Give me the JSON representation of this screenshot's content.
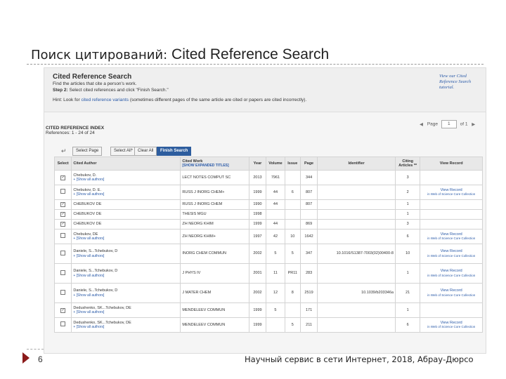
{
  "slide": {
    "title_ru": "Поиск цитирований:",
    "title_en": "Cited Reference Search",
    "page_number": "6",
    "footer": "Научный сервис в сети Интернет, 2018, Абрау-Дюрсо"
  },
  "header": {
    "title": "Cited Reference Search",
    "subtitle": "Find the articles that cite a person's work.",
    "step_label": "Step 2:",
    "step_text": "Select cited references and click \"Finish Search.\"",
    "hint_pre": "Hint: Look for",
    "hint_link": "cited reference variants",
    "hint_post": "(sometimes different pages of the same article are cited or papers are cited incorrectly).",
    "tutorial_line1": "View our Cited",
    "tutorial_line2": "Reference Search",
    "tutorial_line3": "tutorial."
  },
  "index": {
    "title": "CITED REFERENCE INDEX",
    "refs": "References: 1 - 24 of 24",
    "page_label": "Page",
    "page_value": "1",
    "of_label": "of 1",
    "prev_icon": "◀",
    "next_icon": "▶"
  },
  "toolbar": {
    "select_page": "Select Page",
    "select_all": "Select All*",
    "clear_all": "Clear All",
    "finish": "Finish Search"
  },
  "columns": {
    "select": "Select",
    "cited_author": "Cited Author",
    "cited_work": "Cited Work",
    "show_expanded": "[SHOW EXPANDED TITLES]",
    "year": "Year",
    "volume": "Volume",
    "issue": "Issue",
    "page": "Page",
    "identifier": "Identifier",
    "citing_articles": "Citing Articles **",
    "view_record": "View Record"
  },
  "rows": [
    {
      "checked": true,
      "author": "Chebukov, D.",
      "show": "+ [Show all authors]",
      "work": "LECT NOTES COMPUT SC",
      "year": "2013",
      "volume": "7961",
      "issue": "",
      "page": "344",
      "id": "",
      "citing": "3",
      "view": "",
      "view_sub": ""
    },
    {
      "checked": false,
      "author": "Chebukov, D. E.",
      "show": "+ [Show all authors]",
      "work": "RUSS J INORG CHEM+",
      "year": "1999",
      "volume": "44",
      "issue": "6",
      "page": "807",
      "id": "",
      "citing": "2",
      "view": "View Record",
      "view_sub": "in Web of Science Core Collection"
    },
    {
      "checked": true,
      "author": "CHEBUKOV DE",
      "show": "",
      "work": "RUSS J INORG CHEM",
      "year": "1990",
      "volume": "44",
      "issue": "",
      "page": "807",
      "id": "",
      "citing": "1",
      "view": "",
      "view_sub": ""
    },
    {
      "checked": true,
      "author": "CHEBUKOV DE",
      "show": "",
      "work": "THESIS MGU",
      "year": "1998",
      "volume": "",
      "issue": "",
      "page": "",
      "id": "",
      "citing": "1",
      "view": "",
      "view_sub": ""
    },
    {
      "checked": true,
      "author": "CHEBUKOV DE",
      "show": "",
      "work": "ZH NEORG KHIM",
      "year": "1999",
      "volume": "44",
      "issue": "",
      "page": "869",
      "id": "",
      "citing": "3",
      "view": "",
      "view_sub": ""
    },
    {
      "checked": false,
      "author": "Chebukov, DE",
      "show": "+ [Show all authors]",
      "work": "ZH NEORG KHIM+",
      "year": "1997",
      "volume": "42",
      "issue": "10",
      "page": "1642",
      "id": "",
      "citing": "6",
      "view": "View Record",
      "view_sub": "in Web of Science Core Collection"
    },
    {
      "checked": false,
      "author": "Daniele, S...Tchebukov, D",
      "show": "+ [Show all authors]",
      "work": "INORG CHEM COMMUN",
      "year": "2002",
      "volume": "5",
      "issue": "5",
      "page": "347",
      "id": "10.1016/S1387-7003(02)00400-8",
      "citing": "10",
      "view": "View Record",
      "view_sub": "in Web of Science Core Collection"
    },
    {
      "checked": false,
      "author": "Daniele, S...Tchebukov, D",
      "show": "+ [Show all authors]",
      "work": "J PHYS IV",
      "year": "2001",
      "volume": "11",
      "issue": "PR11",
      "page": "283",
      "id": "",
      "citing": "1",
      "view": "View Record",
      "view_sub": "in Web of Science Core Collection"
    },
    {
      "checked": false,
      "author": "Daniele, S...Tchebukov, D",
      "show": "+ [Show all authors]",
      "work": "J MATER CHEM",
      "year": "2002",
      "volume": "12",
      "issue": "8",
      "page": "2519",
      "id": "10.1039/b203346a",
      "citing": "21",
      "view": "View Record",
      "view_sub": "in Web of Science Core Collection"
    },
    {
      "checked": true,
      "author": "Dedushenko, SK...Tchebukov, DE",
      "show": "+ [Show all authors]",
      "work": "MENDELEEV COMMUN",
      "year": "1999",
      "volume": "5",
      "issue": "",
      "page": "171",
      "id": "",
      "citing": "1",
      "view": "",
      "view_sub": ""
    },
    {
      "checked": false,
      "author": "Dedushenko, SK...Tchebukov, DE",
      "show": "+ [Show all authors]",
      "work": "MENDELEEV COMMUN",
      "year": "1999",
      "volume": "",
      "issue": "5",
      "page": "211",
      "id": "",
      "citing": "6",
      "view": "View Record",
      "view_sub": "in Web of Science Core Collection"
    }
  ]
}
